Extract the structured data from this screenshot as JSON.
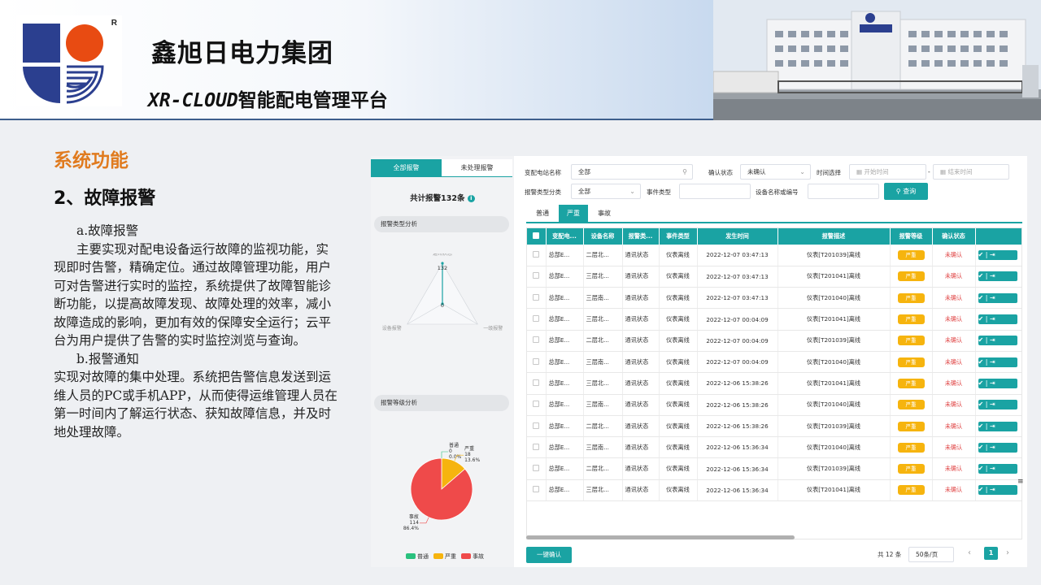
{
  "header": {
    "logo_mark": "R",
    "company": "鑫旭日电力集团",
    "platform_prefix": "XR-CLOUD",
    "platform_suffix": "智能配电管理平台"
  },
  "colors": {
    "accent": "#1aa3a3",
    "warning": "#f6b40e",
    "danger": "#e04545",
    "title_orange": "#e07b1f"
  },
  "section": {
    "title": "系统功能",
    "subtitle": "2、故障报警",
    "para_a_head": "a.故障报警",
    "para_a": "主要实现对配电设备运行故障的监视功能，实现即时告警，精确定位。通过故障管理功能，用户可对告警进行实时的监控，系统提供了故障智能诊断功能，以提高故障发现、故障处理的效率，减小故障造成的影响，更加有效的保障安全运行；云平台为用户提供了告警的实时监控浏览与查询。",
    "para_b_head": "b.报警通知",
    "para_b": "实现对故障的集中处理。系统把告警信息发送到运维人员的PC或手机APP，从而使得运维管理人员在第一时间内了解运行状态、获知故障信息，并及时地处理故障。"
  },
  "app": {
    "left": {
      "tabs": [
        "全部报警",
        "未处理报警"
      ],
      "total_label": "共计报警132条",
      "info_icon": "i",
      "radar_title": "报警类型分析",
      "level_title": "报警等级分析"
    },
    "filters": {
      "station_label": "变配电站名称",
      "station_value": "全部",
      "confirm_label": "确认状态",
      "confirm_value": "未确认",
      "time_label": "时间选择",
      "start_placeholder": "开始时间",
      "end_placeholder": "结束时间",
      "time_sep": "-",
      "category_label": "报警类型分类",
      "category_value": "全部",
      "event_type_label": "事件类型",
      "device_label": "设备名称或编号",
      "query_button": "查询"
    },
    "type_tabs": [
      "普通",
      "严重",
      "事故"
    ],
    "table": {
      "columns": [
        "",
        "变配电...",
        "设备名称",
        "报警类...",
        "事件类型",
        "发生时间",
        "报警描述",
        "报警等级",
        "确认状态",
        "操作"
      ],
      "rows": [
        [
          "总部E...",
          "二层北...",
          "通讯状态",
          "仪表离线",
          "2022-12-07 03:47:13",
          "仪表[T201039]离线",
          "严重",
          "未确认"
        ],
        [
          "总部E...",
          "三层北...",
          "通讯状态",
          "仪表离线",
          "2022-12-07 03:47:13",
          "仪表[T201041]离线",
          "严重",
          "未确认"
        ],
        [
          "总部E...",
          "三层南...",
          "通讯状态",
          "仪表离线",
          "2022-12-07 03:47:13",
          "仪表[T201040]离线",
          "严重",
          "未确认"
        ],
        [
          "总部E...",
          "三层北...",
          "通讯状态",
          "仪表离线",
          "2022-12-07 00:04:09",
          "仪表[T201041]离线",
          "严重",
          "未确认"
        ],
        [
          "总部E...",
          "二层北...",
          "通讯状态",
          "仪表离线",
          "2022-12-07 00:04:09",
          "仪表[T201039]离线",
          "严重",
          "未确认"
        ],
        [
          "总部E...",
          "三层南...",
          "通讯状态",
          "仪表离线",
          "2022-12-07 00:04:09",
          "仪表[T201040]离线",
          "严重",
          "未确认"
        ],
        [
          "总部E...",
          "三层北...",
          "通讯状态",
          "仪表离线",
          "2022-12-06 15:38:26",
          "仪表[T201041]离线",
          "严重",
          "未确认"
        ],
        [
          "总部E...",
          "三层南...",
          "通讯状态",
          "仪表离线",
          "2022-12-06 15:38:26",
          "仪表[T201040]离线",
          "严重",
          "未确认"
        ],
        [
          "总部E...",
          "二层北...",
          "通讯状态",
          "仪表离线",
          "2022-12-06 15:38:26",
          "仪表[T201039]离线",
          "严重",
          "未确认"
        ],
        [
          "总部E...",
          "三层南...",
          "通讯状态",
          "仪表离线",
          "2022-12-06 15:36:34",
          "仪表[T201040]离线",
          "严重",
          "未确认"
        ],
        [
          "总部E...",
          "二层北...",
          "通讯状态",
          "仪表离线",
          "2022-12-06 15:36:34",
          "仪表[T201039]离线",
          "严重",
          "未确认"
        ],
        [
          "总部E...",
          "三层北...",
          "通讯状态",
          "仪表离线",
          "2022-12-06 15:36:34",
          "仪表[T201041]离线",
          "严重",
          "未确认"
        ]
      ],
      "op_icons": [
        "check-circle-icon",
        "exit-icon"
      ]
    },
    "footer": {
      "confirm_all": "一键确认",
      "total": "共 12 条",
      "page_size": "50条/页",
      "prev": "‹",
      "next": "›",
      "current_page": "1",
      "side_glyph": "≡"
    }
  },
  "chart_data": [
    {
      "type": "radar",
      "axes": [
        "通讯状态",
        "一级报警",
        "设备报警"
      ],
      "values": [
        132,
        0,
        0
      ],
      "labels": [
        "132",
        "0",
        "0"
      ]
    },
    {
      "type": "pie",
      "categories": [
        "普通",
        "严重",
        "事故"
      ],
      "values": [
        0,
        18,
        114
      ],
      "percents": [
        "0.0%",
        "13.6%",
        "86.4%"
      ],
      "colors": [
        "#2ac17e",
        "#f6b40e",
        "#ef4a4a"
      ],
      "legend": "bottom"
    }
  ]
}
